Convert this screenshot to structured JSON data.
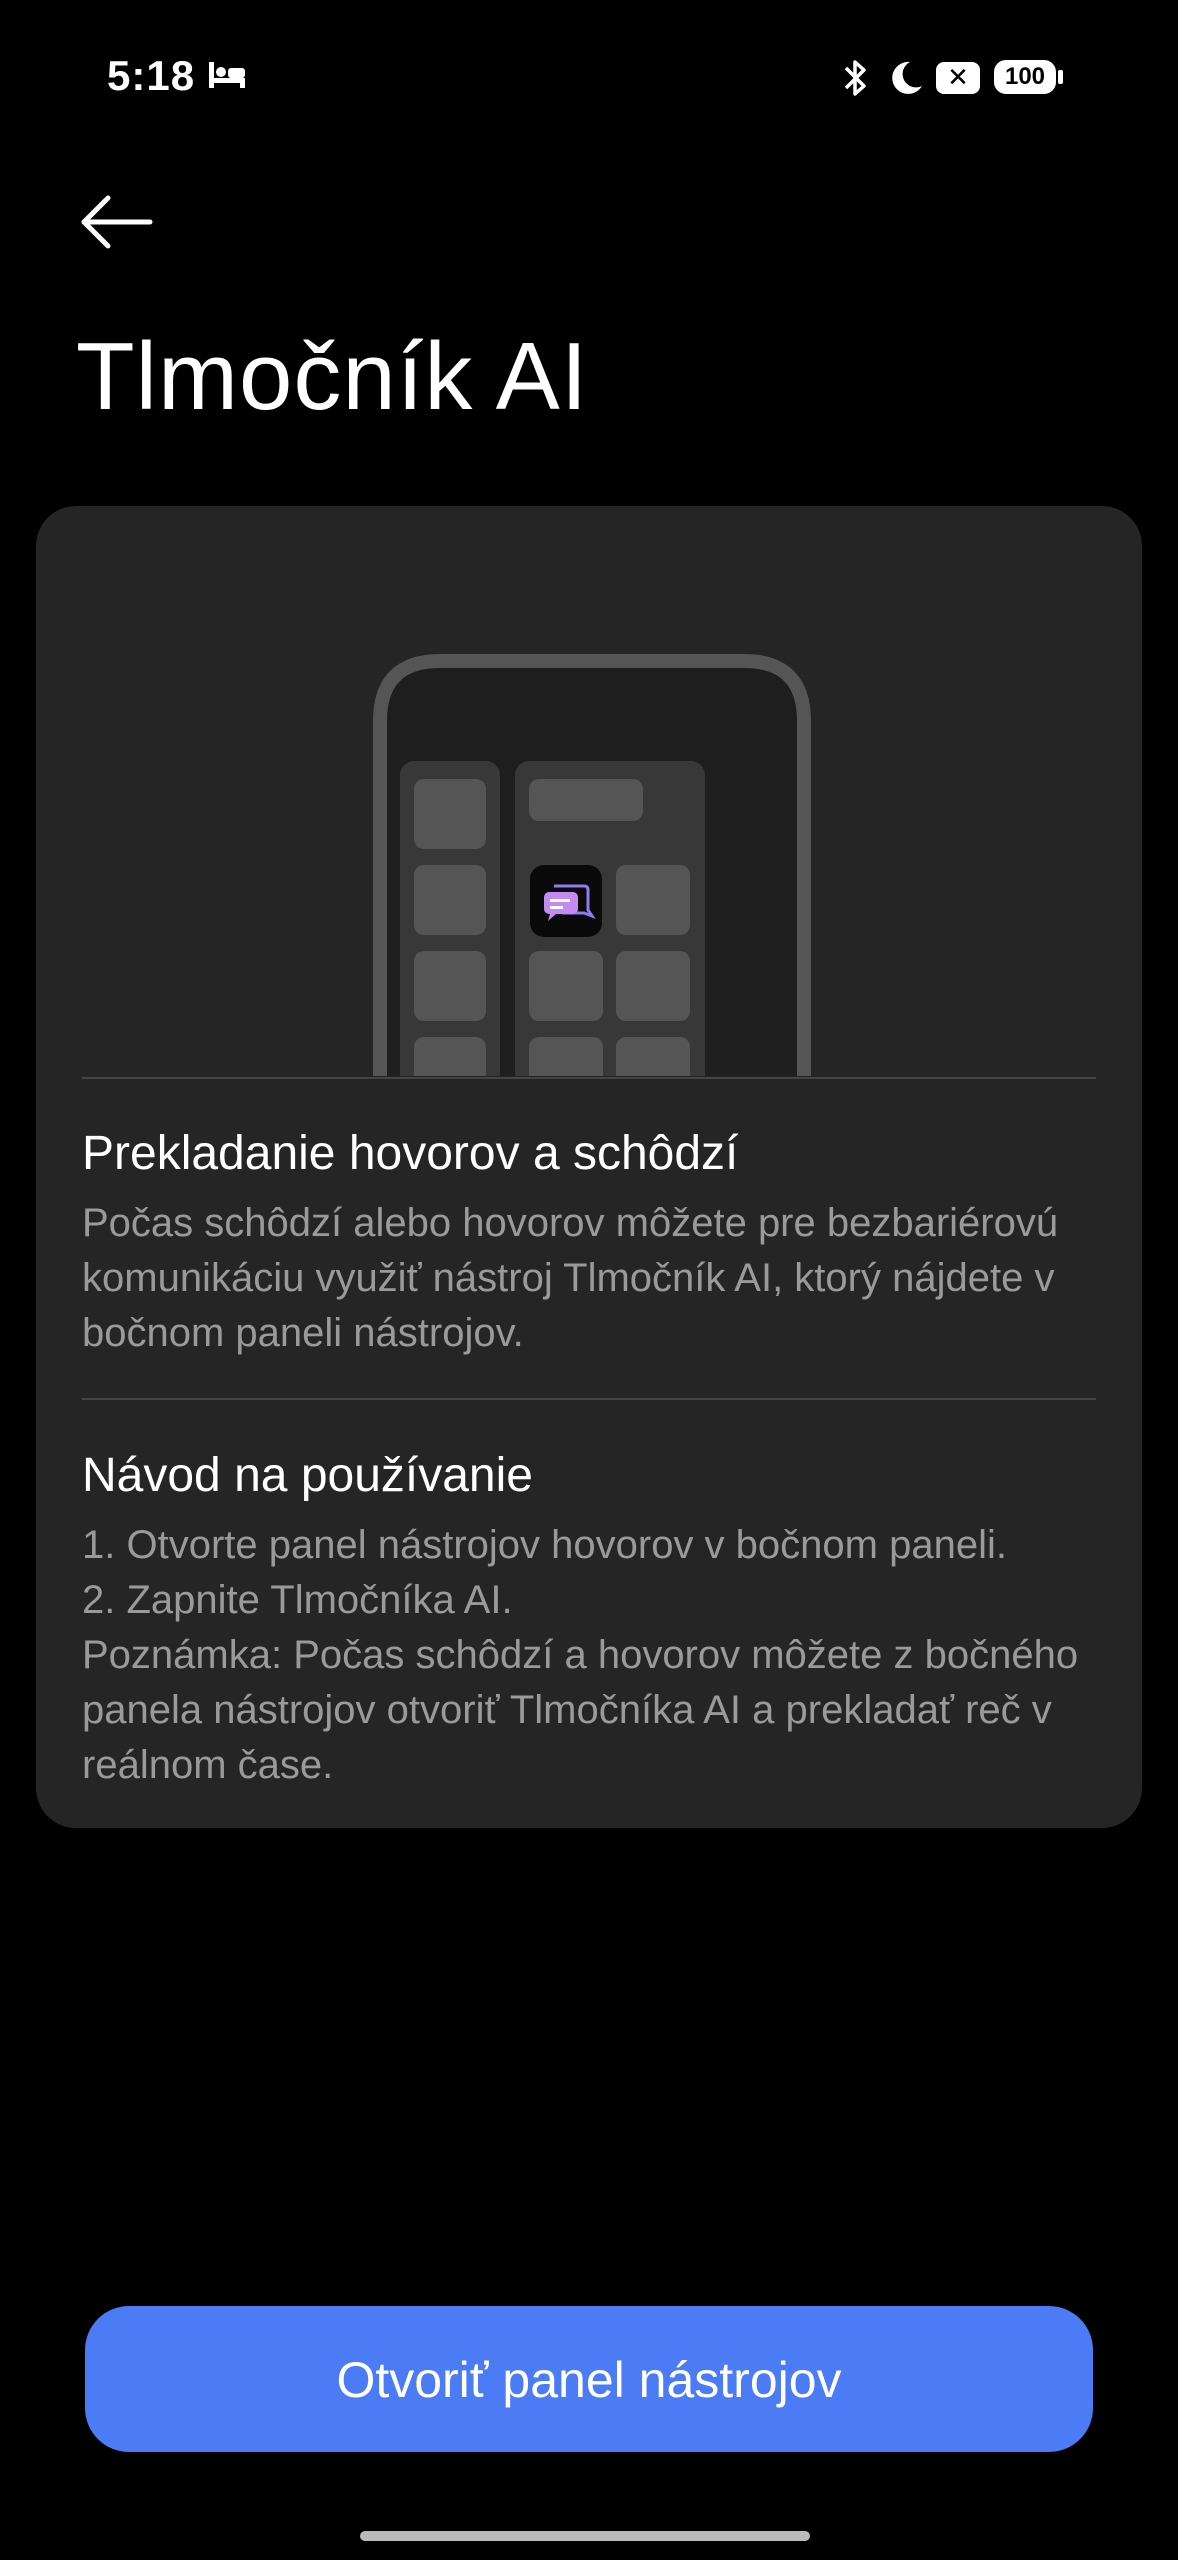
{
  "status_bar": {
    "time": "5:18",
    "battery": "100"
  },
  "header": {
    "title": "Tlmočník AI"
  },
  "card": {
    "section1": {
      "title": "Prekladanie hovorov a schôdzí",
      "body": "Počas schôdzí alebo hovorov môžete pre bezbariérovú komunikáciu využiť nástroj Tlmočník AI, ktorý nájdete v bočnom paneli nástrojov."
    },
    "section2": {
      "title": "Návod na používanie",
      "body": "1. Otvorte panel nástrojov hovorov v bočnom paneli.\n2. Zapnite Tlmočníka AI.\nPoznámka: Počas schôdzí a hovorov môžete z bočného panela nástrojov otvoriť Tlmočníka AI a prekladať reč v reálnom čase."
    }
  },
  "actions": {
    "primary_label": "Otvoriť panel nástrojov"
  },
  "icons": {
    "back": "arrow-left-icon",
    "sleep": "bed-icon",
    "bluetooth": "bluetooth-icon",
    "dnd": "moon-icon",
    "notification": "close-box-icon",
    "translator": "chat-bubbles-icon"
  },
  "colors": {
    "background": "#000000",
    "card": "#252525",
    "accent": "#4b7bf5"
  }
}
